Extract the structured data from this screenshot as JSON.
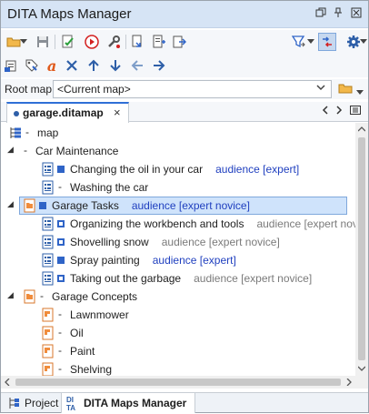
{
  "window": {
    "title": "DITA Maps Manager",
    "controls": [
      "restore-icon",
      "pin-icon",
      "close-icon"
    ]
  },
  "toolbar_row1": [
    "open-folder-icon",
    "dropdown-arrow-icon",
    "save-icon",
    "validate-icon",
    "run-transform-icon",
    "configure-transform-icon",
    "insert-reference-icon",
    "insert-topic-icon",
    "export-icon",
    "filter-icon",
    "link-toggle-icon",
    "settings-icon"
  ],
  "toolbar_row2": [
    "new-topic-icon",
    "edit-properties-icon",
    "rename-icon",
    "delete-icon",
    "move-up-icon",
    "move-down-icon",
    "promote-icon",
    "demote-icon"
  ],
  "root_map": {
    "label": "Root map:",
    "value": "<Current map>"
  },
  "doc_tab": {
    "label": "garage.ditamap",
    "close": "×"
  },
  "colors": {
    "accent": "#2f6fd6",
    "selection": "#cfe3fb",
    "audience_blue": "#1f3fbf",
    "audience_gray": "#7a7a7a"
  },
  "tree": [
    {
      "level": 0,
      "twisty": "",
      "icon": "map-icon",
      "bullet": "",
      "text": "map",
      "attr": "",
      "attr_style": ""
    },
    {
      "level": 0,
      "twisty": "◢",
      "icon": "",
      "bullet": "",
      "text": "Car Maintenance",
      "attr": "",
      "attr_style": ""
    },
    {
      "level": 1,
      "twisty": "",
      "icon": "topic-icon",
      "bullet": "filled",
      "text": "Changing the oil in your car",
      "attr": "audience [expert]",
      "attr_style": "blue"
    },
    {
      "level": 1,
      "twisty": "",
      "icon": "topic-icon",
      "bullet": "",
      "text": "Washing the car",
      "attr": "",
      "attr_style": ""
    },
    {
      "level": 0,
      "twisty": "◢",
      "icon": "folder-topic-icon",
      "bullet": "filled",
      "text": "Garage Tasks",
      "attr": "audience [expert novice]",
      "attr_style": "blue",
      "selected": true
    },
    {
      "level": 1,
      "twisty": "",
      "icon": "topic-icon",
      "bullet": "hollow",
      "text": "Organizing the workbench and tools",
      "attr": "audience [expert novice]",
      "attr_style": "gray"
    },
    {
      "level": 1,
      "twisty": "",
      "icon": "topic-icon",
      "bullet": "hollow",
      "text": "Shovelling snow",
      "attr": "audience [expert novice]",
      "attr_style": "gray"
    },
    {
      "level": 1,
      "twisty": "",
      "icon": "topic-icon",
      "bullet": "filled",
      "text": "Spray painting",
      "attr": "audience [expert]",
      "attr_style": "blue"
    },
    {
      "level": 1,
      "twisty": "",
      "icon": "topic-icon",
      "bullet": "hollow",
      "text": "Taking out the garbage",
      "attr": "audience [expert novice]",
      "attr_style": "gray"
    },
    {
      "level": 0,
      "twisty": "◢",
      "icon": "folder-topic-icon",
      "bullet": "",
      "text": "Garage Concepts",
      "attr": "",
      "attr_style": ""
    },
    {
      "level": 1,
      "twisty": "",
      "icon": "concept-icon",
      "bullet": "",
      "text": "Lawnmower",
      "attr": "",
      "attr_style": ""
    },
    {
      "level": 1,
      "twisty": "",
      "icon": "concept-icon",
      "bullet": "",
      "text": "Oil",
      "attr": "",
      "attr_style": ""
    },
    {
      "level": 1,
      "twisty": "",
      "icon": "concept-icon",
      "bullet": "",
      "text": "Paint",
      "attr": "",
      "attr_style": ""
    },
    {
      "level": 1,
      "twisty": "",
      "icon": "concept-icon",
      "bullet": "",
      "text": "Shelving",
      "attr": "",
      "attr_style": ""
    }
  ],
  "bottom_tabs": [
    {
      "label": "Project",
      "icon": "project-icon",
      "active": false
    },
    {
      "label": "DITA Maps Manager",
      "icon": "dita-icon",
      "active": true
    }
  ]
}
